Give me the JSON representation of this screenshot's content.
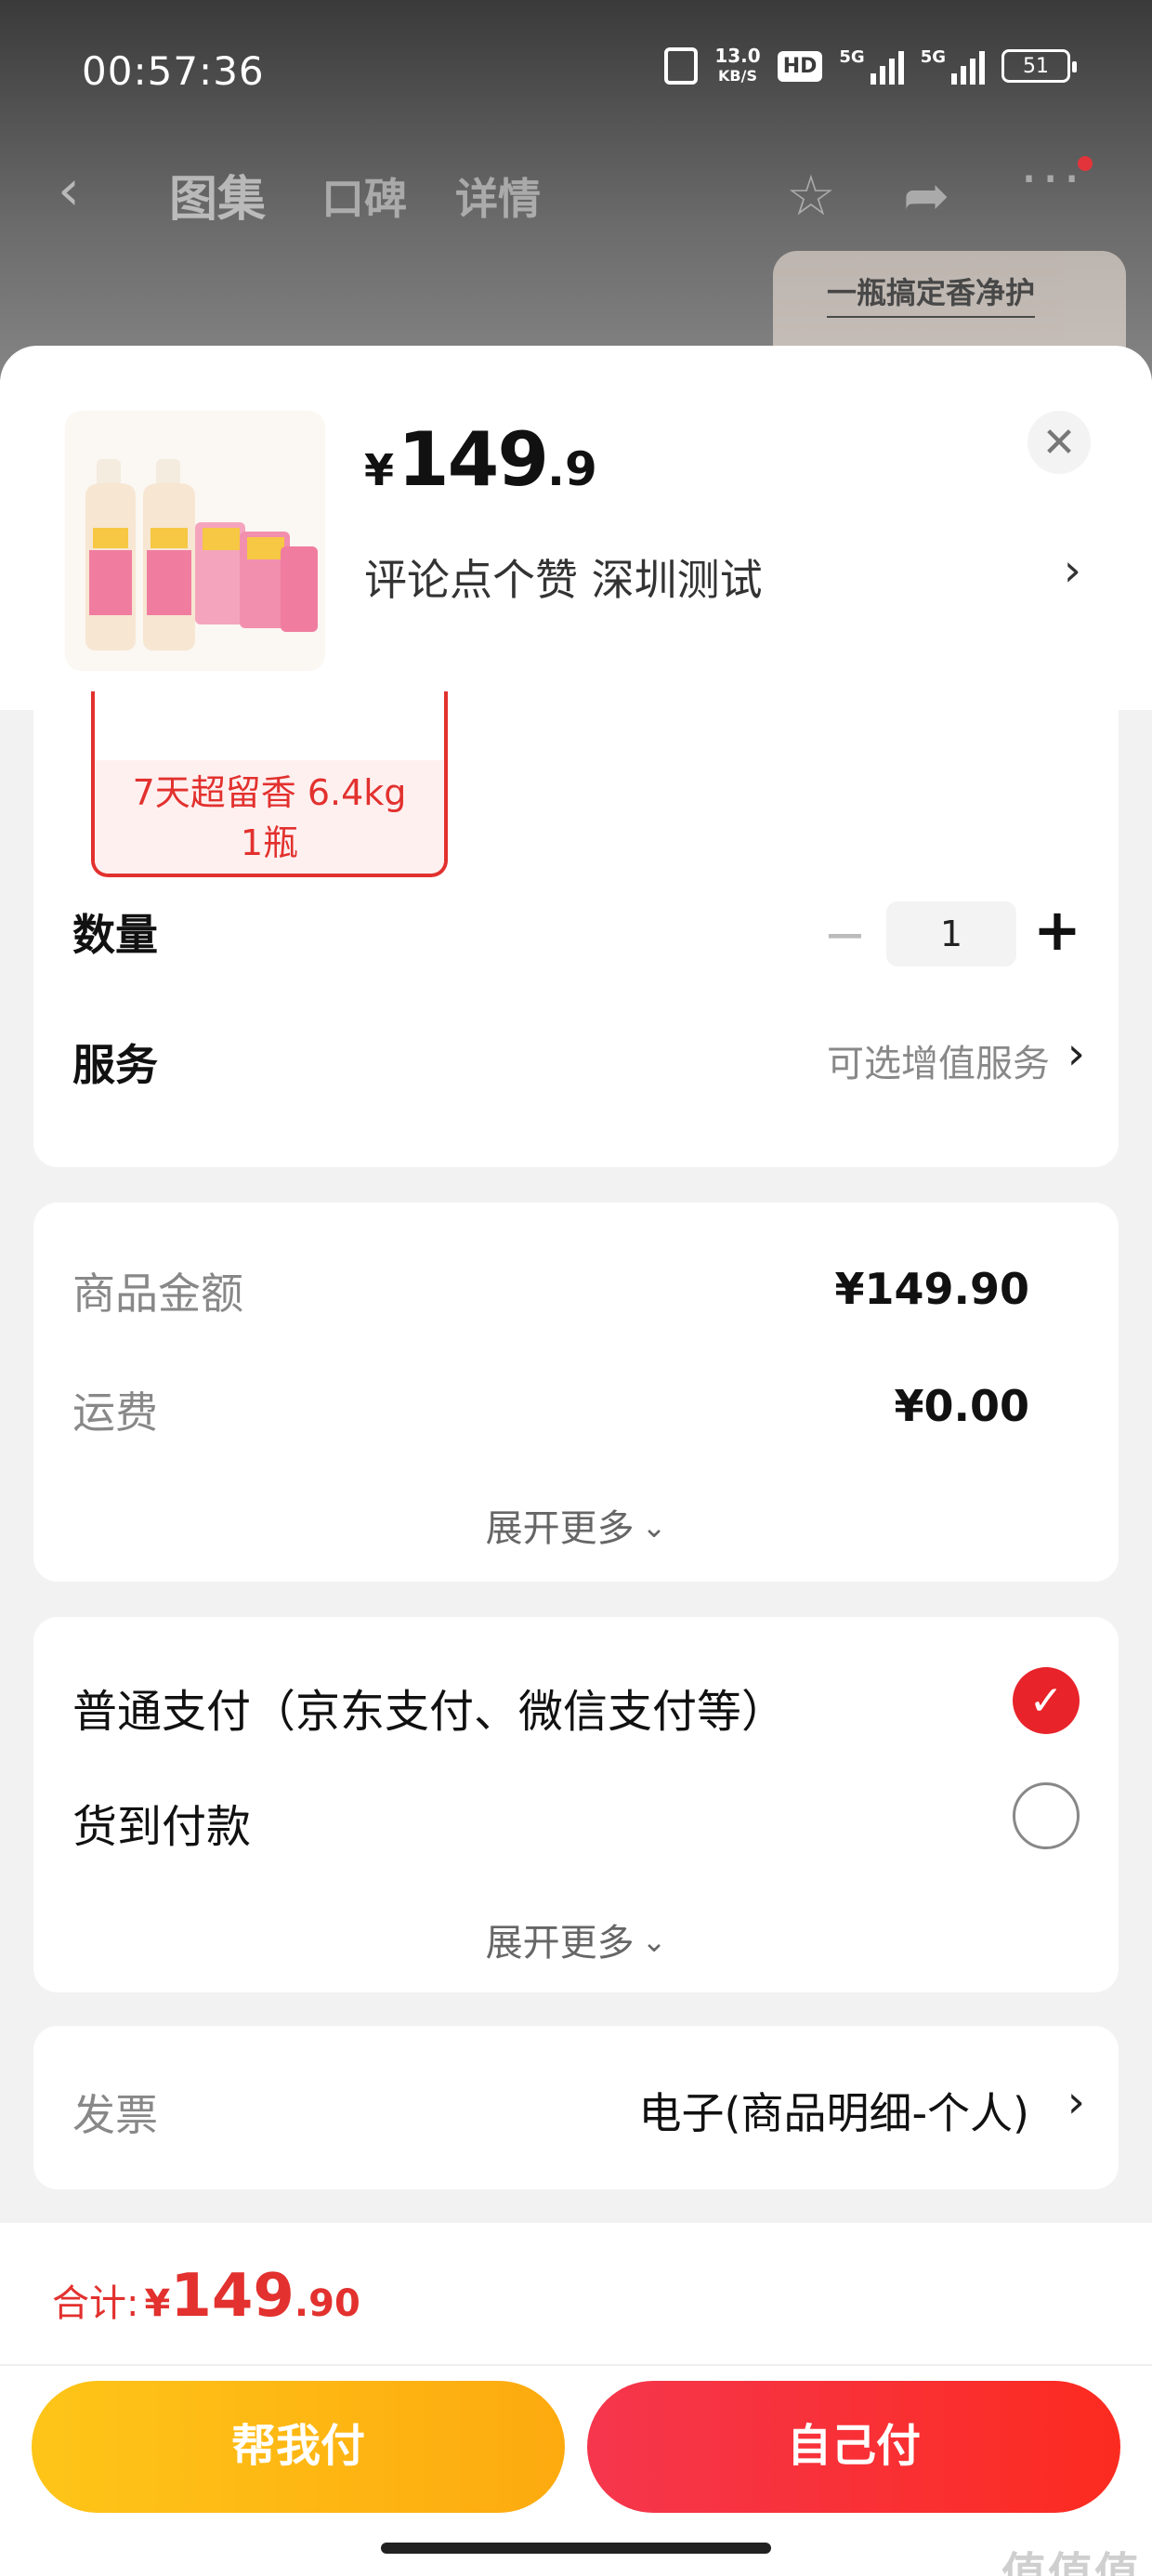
{
  "status_bar": {
    "time": "00:57:36",
    "net_speed_value": "13.0",
    "net_speed_unit": "KB/S",
    "hd_label": "HD",
    "signal_1": "5G",
    "signal_2": "5G",
    "battery": "51"
  },
  "nav": {
    "back_icon": "chevron-left-icon",
    "tabs": [
      "图集",
      "口碑",
      "详情"
    ],
    "icons": [
      "star-icon",
      "share-icon",
      "more-icon"
    ]
  },
  "promo": {
    "text": "一瓶搞定香净护"
  },
  "sheet": {
    "price": {
      "currency": "¥",
      "integer": "149",
      "decimal": ".9"
    },
    "address": "评论点个赞  深圳测试",
    "close_icon": "close-icon"
  },
  "spec": {
    "selected_line1": "7天超留香 6.4kg",
    "selected_line2": "1瓶",
    "quantity_label": "数量",
    "quantity_minus": "−",
    "quantity_value": "1",
    "quantity_plus": "+",
    "service_label": "服务",
    "service_value": "可选增值服务"
  },
  "amounts": {
    "goods_label": "商品金额",
    "goods_value": "¥149.90",
    "shipping_label": "运费",
    "shipping_value": "¥0.00",
    "expand_label": "展开更多"
  },
  "payment": {
    "options": [
      {
        "label": "普通支付（京东支付、微信支付等）",
        "selected": true
      },
      {
        "label": "货到付款",
        "selected": false
      }
    ],
    "expand_label": "展开更多"
  },
  "invoice": {
    "label": "发票",
    "value": "电子(商品明细-个人)"
  },
  "footer": {
    "total_label": "合计:",
    "total_currency": "¥",
    "total_integer": "149",
    "total_decimal": ".90",
    "help_pay_label": "帮我付",
    "self_pay_label": "自己付",
    "watermark": "值值值"
  },
  "colors": {
    "accent_red": "#e2312e",
    "pay_red": "#fc2b20",
    "help_yellow": "#fdaa0f"
  }
}
